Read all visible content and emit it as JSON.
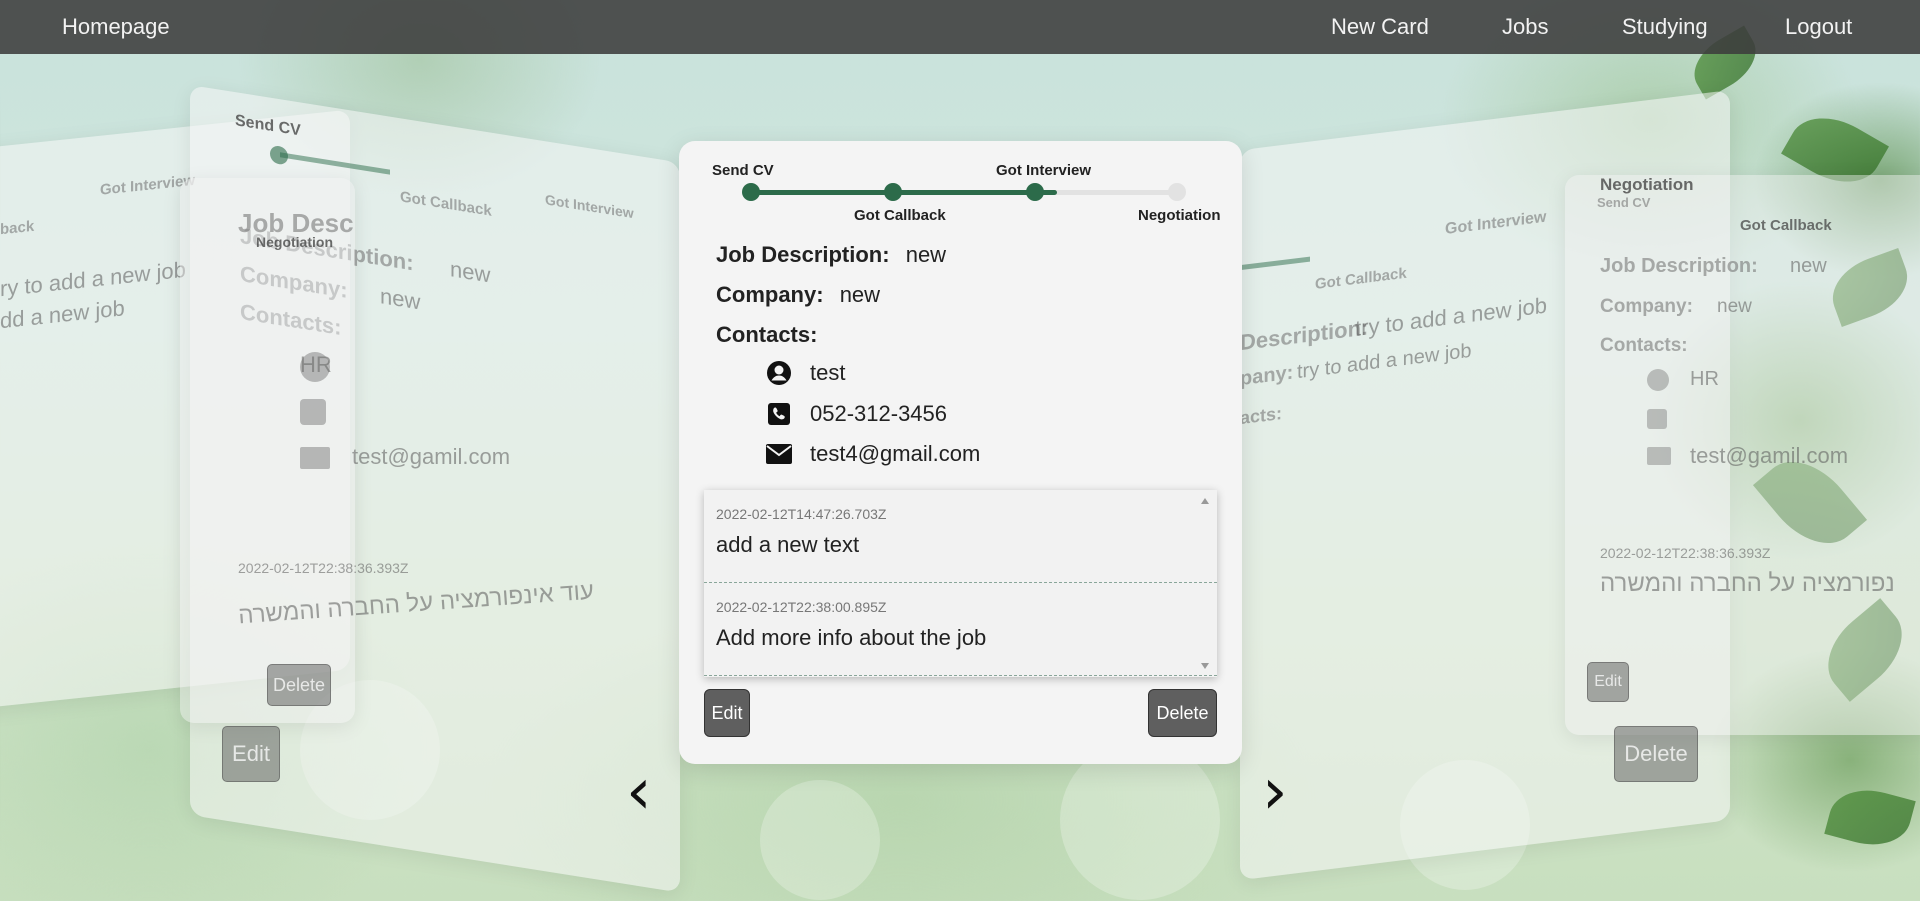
{
  "nav": {
    "home": "Homepage",
    "new_card": "New Card",
    "jobs": "Jobs",
    "studying": "Studying",
    "logout": "Logout"
  },
  "card": {
    "stages": [
      "Send CV",
      "Got Callback",
      "Got Interview",
      "Negotiation"
    ],
    "current_stage_index": 2,
    "job_description_label": "Job Description:",
    "job_description": "new",
    "company_label": "Company:",
    "company": "new",
    "contacts_label": "Contacts:",
    "contact_name": "test",
    "contact_phone": "052-312-3456",
    "contact_email": "test4@gmail.com",
    "notes": [
      {
        "date": "2022-02-12T14:47:26.703Z",
        "text": "add a new text"
      },
      {
        "date": "2022-02-12T22:38:00.895Z",
        "text": "Add more info about the job"
      }
    ],
    "edit_label": "Edit",
    "delete_label": "Delete"
  },
  "left_card": {
    "stages": [
      "Send CV",
      "Got Callback",
      "Got Interview",
      "Negotiation"
    ],
    "job_description_label": "Job Description:",
    "job_description": "new",
    "company_label": "Company:",
    "company": "new",
    "contacts_label": "Contacts:",
    "contact_name": "HR",
    "contact_email": "test@gamil.com",
    "note_date": "2022-02-12T22:38:36.393Z",
    "note_text": "עוד אינפורמציה על החברה והמשרה",
    "edit_label": "Edit",
    "delete_label": "Delete"
  },
  "far_left_card": {
    "stage_a": "back",
    "stage_b": "Got Interview",
    "line1": "ry to add a new job",
    "line2": "dd a new job"
  },
  "right_card": {
    "stage_a": "Got Callback",
    "stage_b": "Got Interview",
    "job_description_label": "Description:",
    "job_description": "try to add a new job",
    "company_label": "pany:",
    "company": "try to add a new job",
    "contacts_label": "acts:"
  },
  "far_right_card": {
    "stages": [
      "Negotiation",
      "Send CV",
      "Got Callback"
    ],
    "job_description_label": "Job Description:",
    "job_description": "new",
    "company_label": "Company:",
    "company": "new",
    "contacts_label": "Contacts:",
    "contact_name": "HR",
    "contact_email": "test@gamil.com",
    "note_date": "2022-02-12T22:38:36.393Z",
    "note_text": "נפורמציה על החברה והמשרה",
    "edit_label": "Edit",
    "delete_label": "Delete"
  },
  "carousel": {
    "prev": "‹",
    "next": "›"
  }
}
